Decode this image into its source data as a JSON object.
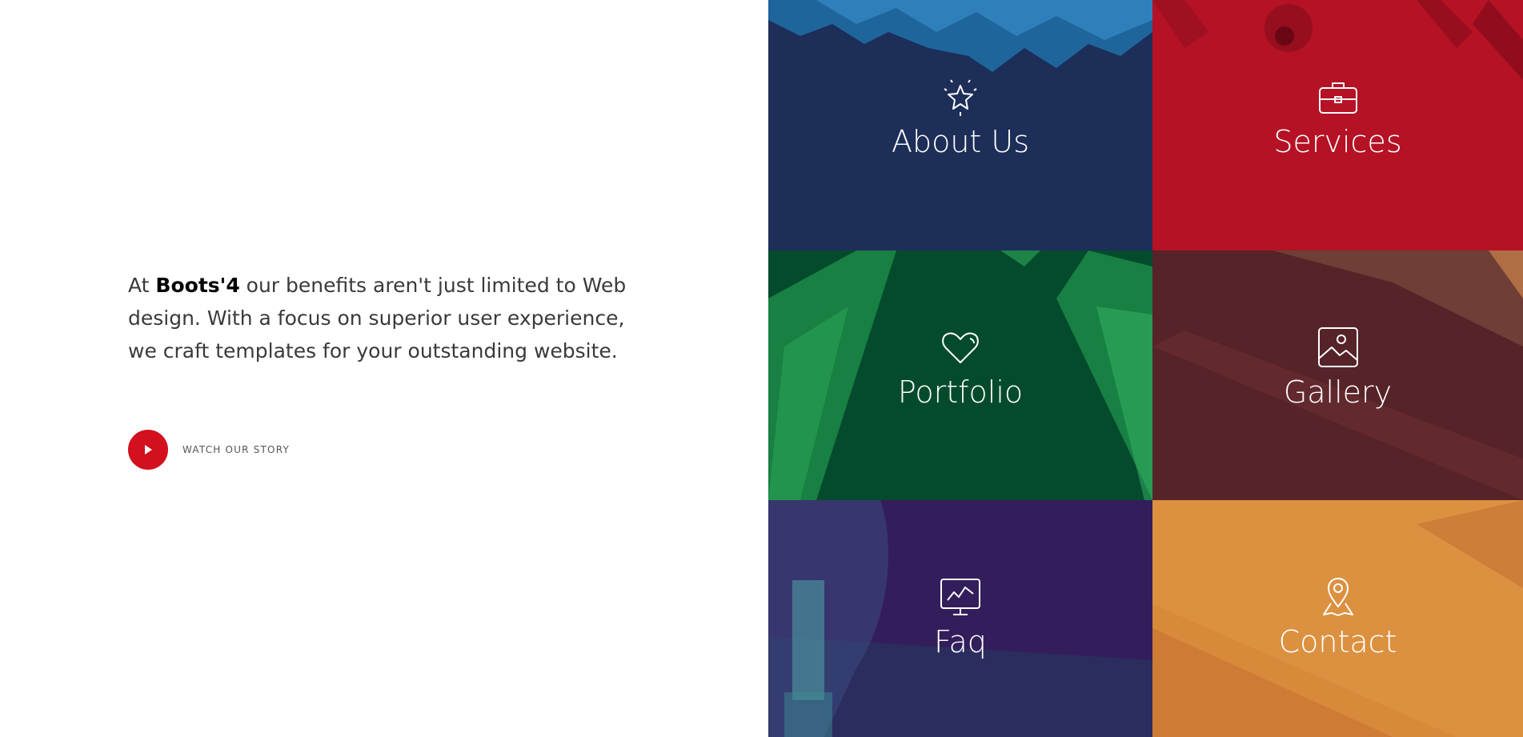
{
  "intro": {
    "prefix": "At ",
    "brand": "Boots'4",
    "suffix": " our benefits aren't just limited to Web design. With a focus on superior user experience, we craft templates for your outstanding website."
  },
  "watch": {
    "label": "WATCH OUR STORY",
    "icon": "play-icon"
  },
  "tiles": [
    {
      "label": "About Us",
      "icon": "star-icon",
      "color": "#1d2e58"
    },
    {
      "label": "Services",
      "icon": "briefcase-icon",
      "color": "#b51226"
    },
    {
      "label": "Portfolio",
      "icon": "heart-icon",
      "color": "#044b2e"
    },
    {
      "label": "Gallery",
      "icon": "image-icon",
      "color": "#562328"
    },
    {
      "label": "Faq",
      "icon": "monitor-chart-icon",
      "color": "#331e5b"
    },
    {
      "label": "Contact",
      "icon": "map-pin-icon",
      "color": "#d8893a"
    }
  ],
  "colors": {
    "accent": "#d2101e",
    "text": "#3a3a3a"
  }
}
